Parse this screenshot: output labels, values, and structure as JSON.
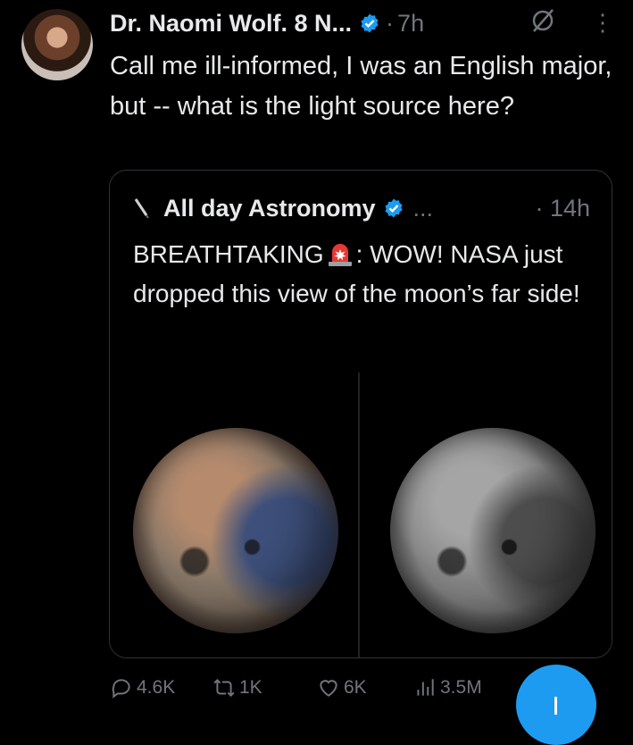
{
  "tweet": {
    "author": "Dr. Naomi Wolf. 8 N...",
    "separator": "·",
    "time": "7h",
    "text": "Call me ill-informed, I was an English major, but -- what is the light source here?"
  },
  "quoted": {
    "author": "All day Astronomy",
    "handle": "...",
    "time": "· 14h",
    "text_part1": "BREATHTAKING",
    "text_part2": ": WOW! NASA just dropped this view of the moon’s far side!"
  },
  "actions": {
    "replies": "4.6K",
    "reposts": "1K",
    "likes": "6K",
    "views": "3.5M"
  },
  "colors": {
    "background": "#000000",
    "text": "#e7e9ea",
    "muted": "#71767b",
    "accent": "#1d9bf0",
    "border": "#2f3336"
  },
  "icons": [
    "verified-badge-icon",
    "grok-icon",
    "more-icon",
    "telescope-icon",
    "siren-emoji-icon",
    "reply-icon",
    "repost-icon",
    "like-icon",
    "views-icon",
    "compose-icon"
  ]
}
